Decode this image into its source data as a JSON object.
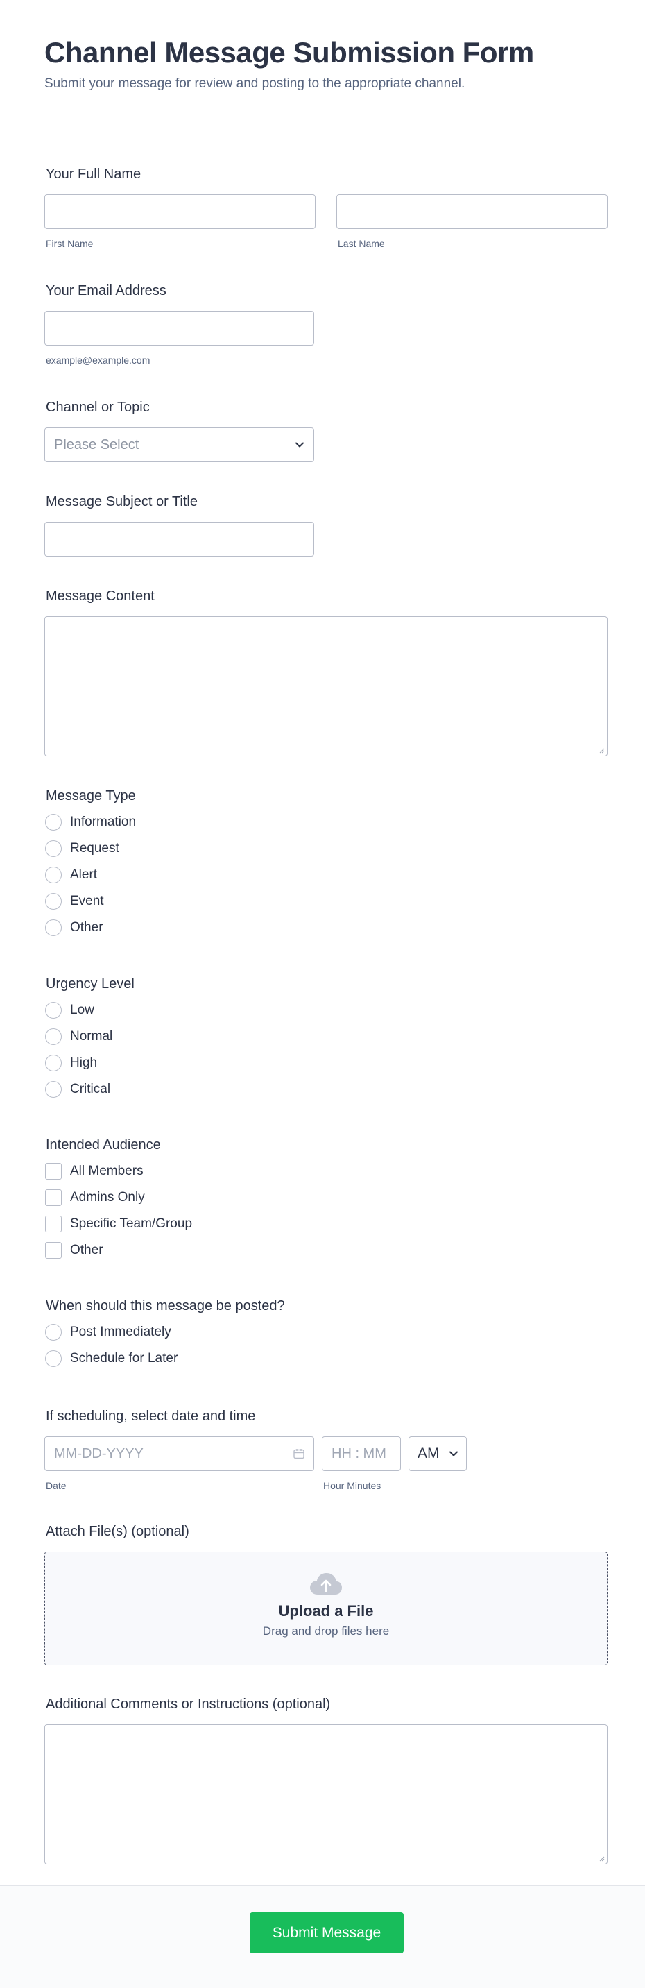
{
  "header": {
    "title": "Channel Message Submission Form",
    "subtitle": "Submit your message for review and posting to the appropriate channel."
  },
  "full_name": {
    "label": "Your Full Name",
    "first_sublabel": "First Name",
    "last_sublabel": "Last Name",
    "first_value": "",
    "last_value": ""
  },
  "email": {
    "label": "Your Email Address",
    "sublabel": "example@example.com",
    "value": ""
  },
  "channel": {
    "label": "Channel or Topic",
    "selected": "Please Select"
  },
  "subject": {
    "label": "Message Subject or Title",
    "value": ""
  },
  "content": {
    "label": "Message Content",
    "value": ""
  },
  "message_type": {
    "label": "Message Type",
    "options": [
      "Information",
      "Request",
      "Alert",
      "Event",
      "Other"
    ]
  },
  "urgency": {
    "label": "Urgency Level",
    "options": [
      "Low",
      "Normal",
      "High",
      "Critical"
    ]
  },
  "audience": {
    "label": "Intended Audience",
    "options": [
      "All Members",
      "Admins Only",
      "Specific Team/Group",
      "Other"
    ]
  },
  "posting": {
    "label": "When should this message be posted?",
    "options": [
      "Post Immediately",
      "Schedule for Later"
    ]
  },
  "schedule": {
    "label": "If scheduling, select date and time",
    "date_placeholder": "MM-DD-YYYY",
    "date_sublabel": "Date",
    "time_placeholder": "HH : MM",
    "time_sublabel": "Hour Minutes",
    "ampm": "AM"
  },
  "attach": {
    "label": "Attach File(s) (optional)",
    "title": "Upload a File",
    "subtitle": "Drag and drop files here"
  },
  "comments": {
    "label": "Additional Comments or Instructions (optional)",
    "value": ""
  },
  "submit": {
    "label": "Submit Message"
  },
  "colors": {
    "accent": "#18bd5b",
    "text": "#2c3345",
    "muted": "#57647e",
    "border": "#b8bdc9"
  },
  "icons": {
    "select_chevron": "chevron-down-icon",
    "calendar": "calendar-icon",
    "upload": "cloud-upload-icon"
  }
}
